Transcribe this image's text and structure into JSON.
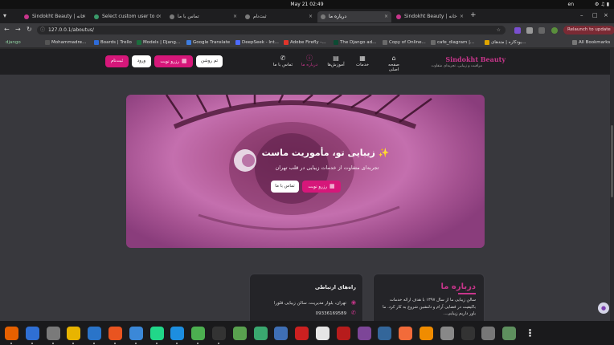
{
  "system": {
    "clock": "May 21  02:49",
    "lang": "en"
  },
  "browser": {
    "tabs": [
      {
        "title": "Sindokht Beauty | خانه"
      },
      {
        "title": "Select custom user to c"
      },
      {
        "title": "تماس با ما"
      },
      {
        "title": "ثبت‌نام"
      },
      {
        "title": "درباره ما"
      },
      {
        "title": "Sindokht Beauty | خانه"
      }
    ],
    "url": "127.0.0.1/aboutus/",
    "relaunch_label": "Relaunch to update",
    "bookmarks": [
      "django",
      "Mohammadre...",
      "Boards | Trello",
      "Models | Djang...",
      "Google Translate",
      "DeepSeek - Int...",
      "Adobe Firefly -...",
      "The Django ad...",
      "Copy of Online...",
      "cafe_diagram |...",
      "بودکاره | متدهای...",
      "All Bookmarks"
    ]
  },
  "site": {
    "brand_name": "Sindokht Beauty",
    "brand_tagline": "مراقبت و زیبایی، تجربه‌ای متفاوت",
    "nav": [
      {
        "label": "صفحه اصلی",
        "icon": "home-icon"
      },
      {
        "label": "خدمات",
        "icon": "services-icon"
      },
      {
        "label": "آموزش‌ها",
        "icon": "book-icon"
      },
      {
        "label": "درباره ما",
        "icon": "info-icon"
      },
      {
        "label": "تماس با ما",
        "icon": "phone-icon"
      }
    ],
    "theme_toggle": "تم روشن",
    "booking_btn": "رزرو نوبت",
    "login_btn": "ورود",
    "signup_btn": "ثبت‌نام",
    "accent": "#d6177a"
  },
  "hero": {
    "title": "زیبایی تو، مأموریت ماست ✨",
    "subtitle": "تجربه‌ای متفاوت از خدمات زیبایی در قلب تهران",
    "booking_btn": "رزرو نوبت",
    "contact_btn": "تماس با ما"
  },
  "about": {
    "title": "درباره ما",
    "text": "سالن زیبایی ما از سال ۱۳۹۷ با هدف ارائه خدمات باکیفیت در فضایی آرام و دلنشین شروع به کار کرد. ما باور داریم زیبایی..."
  },
  "contact": {
    "title": "راه‌های ارتباطی",
    "address": "تهران، بلوار مدیریت، سالن زیبایی فلورا",
    "phone": "09336169589"
  },
  "dock": [
    {
      "name": "firefox",
      "color": "#e66000"
    },
    {
      "name": "thunderbird",
      "color": "#2f6fd4"
    },
    {
      "name": "files",
      "color": "#7a7a7a"
    },
    {
      "name": "rhythmbox",
      "color": "#e8b400"
    },
    {
      "name": "libreoffice-writer",
      "color": "#2a74c9"
    },
    {
      "name": "app-center",
      "color": "#e95420"
    },
    {
      "name": "help",
      "color": "#3b88d8"
    },
    {
      "name": "pycharm",
      "color": "#21d789"
    },
    {
      "name": "vscode",
      "color": "#1d8ee0"
    },
    {
      "name": "chrome",
      "color": "#4caf50"
    },
    {
      "name": "obs",
      "color": "#333333"
    },
    {
      "name": "screenshot",
      "color": "#59a14f"
    },
    {
      "name": "image-viewer",
      "color": "#3aa86f"
    },
    {
      "name": "dbeaver",
      "color": "#3f6fb5"
    },
    {
      "name": "acrobat",
      "color": "#cc2020"
    },
    {
      "name": "xournal",
      "color": "#e6e6e6"
    },
    {
      "name": "redis",
      "color": "#b71c1c"
    },
    {
      "name": "tor",
      "color": "#7d4698"
    },
    {
      "name": "postgres",
      "color": "#33669a"
    },
    {
      "name": "postman",
      "color": "#f26b3a"
    },
    {
      "name": "vlc",
      "color": "#f08c00"
    },
    {
      "name": "settings",
      "color": "#888888"
    },
    {
      "name": "terminal",
      "color": "#333333"
    },
    {
      "name": "drive",
      "color": "#777777"
    },
    {
      "name": "trash",
      "color": "#5e8f5e"
    },
    {
      "name": "show-apps",
      "color": "#1a1a1c"
    }
  ]
}
